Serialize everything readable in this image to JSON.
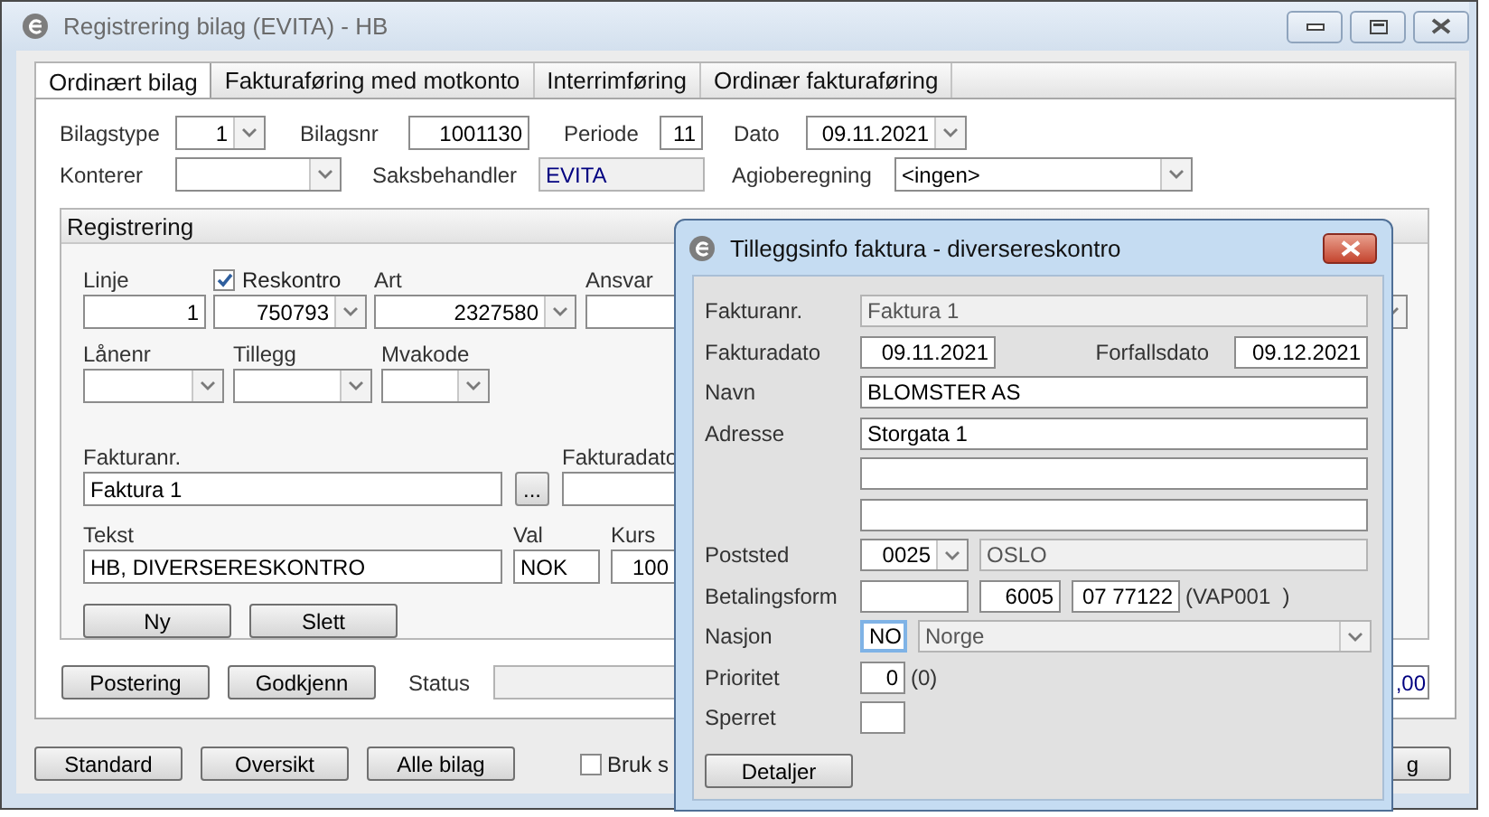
{
  "window": {
    "title": "Registrering bilag (EVITA) - HB"
  },
  "tabs": [
    {
      "label": "Ordinært bilag",
      "selected": true
    },
    {
      "label": "Fakturaføring med motkonto",
      "selected": false
    },
    {
      "label": "Interrimføring",
      "selected": false
    },
    {
      "label": "Ordinær fakturaføring",
      "selected": false
    }
  ],
  "header_rows": [
    [
      {
        "label": "Bilagstype",
        "kind": "combo",
        "value": "1"
      },
      {
        "label": "Bilagsnr",
        "kind": "text",
        "value": "1001130"
      },
      {
        "label": "Periode",
        "kind": "text",
        "value": "11"
      },
      {
        "label": "Dato",
        "kind": "combo",
        "value": "09.11.2021"
      }
    ],
    [
      {
        "label": "Konterer",
        "kind": "combo"
      },
      {
        "label": "Saksbehandler",
        "kind": "readonly",
        "value": "EVITA"
      },
      {
        "label": "Agioberegning",
        "kind": "combo",
        "value": "<ingen>"
      }
    ]
  ],
  "registrering": {
    "title": "Registrering",
    "rows": [
      [
        {
          "label": "Linje",
          "kind": "text",
          "value": "1"
        },
        {
          "label": "Reskontro",
          "checked": true,
          "kind": "combo",
          "value": "750793"
        },
        {
          "label": "Art",
          "kind": "combo",
          "value": "2327580"
        },
        {
          "label": "Ansvar",
          "kind": "text"
        },
        {
          "kind": "combo"
        }
      ],
      [
        {
          "label": "Lånenr",
          "kind": "combo"
        },
        {
          "label": "Tillegg",
          "kind": "combo"
        },
        {
          "label": "Mvakode",
          "kind": "combo"
        }
      ],
      [
        {
          "label": "Fakturanr.",
          "kind": "text",
          "value": "Faktura 1"
        },
        {
          "kind": "button",
          "value": "..."
        },
        {
          "label": "Fakturadato",
          "kind": "text"
        }
      ],
      [
        {
          "label": "Tekst",
          "kind": "text",
          "value": "HB, DIVERSERESKONTRO"
        },
        {
          "label": "Val",
          "kind": "text",
          "value": "NOK"
        },
        {
          "label": "Kurs",
          "kind": "text",
          "value": "100"
        }
      ]
    ],
    "buttons": [
      "Ny",
      "Slett"
    ]
  },
  "actions": {
    "buttons": [
      "Postering",
      "Godkjenn"
    ],
    "status_label": "Status",
    "amount": ",00"
  },
  "footer": {
    "buttons": [
      "Standard",
      "Oversikt",
      "Alle bilag"
    ],
    "checkbox": {
      "label": "Bruk s",
      "checked": false
    },
    "right_button": "g"
  },
  "dialog": {
    "title": "Tilleggsinfo faktura - diversereskontro",
    "rows": [
      {
        "label": "Fakturanr.",
        "fields": [
          {
            "kind": "readonly",
            "value": "Faktura 1"
          }
        ]
      },
      {
        "label": "Fakturadato",
        "fields": [
          {
            "kind": "text",
            "value": "09.11.2021",
            "focused": false
          },
          {
            "kind": "label",
            "value": "Forfallsdato"
          },
          {
            "kind": "text",
            "value": "09.12.2021",
            "focused": false
          }
        ]
      },
      {
        "label": "Navn",
        "fields": [
          {
            "kind": "text",
            "value": "BLOMSTER AS",
            "focused": false
          }
        ]
      },
      {
        "label": "Adresse",
        "fields": [
          {
            "kind": "text",
            "value": "Storgata 1",
            "focused": false
          }
        ]
      },
      {
        "fields": [
          {
            "kind": "text",
            "focused": false
          }
        ]
      },
      {
        "fields": [
          {
            "kind": "text",
            "focused": false
          }
        ]
      },
      {
        "label": "Poststed",
        "fields": [
          {
            "kind": "combo",
            "value": "0025"
          },
          {
            "kind": "readonly",
            "value": "OSLO"
          }
        ]
      },
      {
        "label": "Betalingsform",
        "fields": [
          {
            "kind": "text",
            "focused": false
          },
          {
            "kind": "text",
            "value": "6005",
            "focused": false
          },
          {
            "kind": "text",
            "value": "07 77122",
            "focused": false
          },
          {
            "kind": "note",
            "value": "(VAP001  )"
          }
        ]
      },
      {
        "label": "Nasjon",
        "fields": [
          {
            "kind": "text",
            "value": "NO",
            "focused": true
          },
          {
            "kind": "readonly_combo",
            "value": "Norge"
          }
        ]
      },
      {
        "label": "Prioritet",
        "fields": [
          {
            "kind": "text",
            "value": "0",
            "focused": false
          },
          {
            "kind": "note",
            "value": "(0)"
          }
        ]
      },
      {
        "label": "Sperret",
        "fields": [
          {
            "kind": "text",
            "focused": false
          }
        ]
      }
    ],
    "button": "Detaljer"
  }
}
